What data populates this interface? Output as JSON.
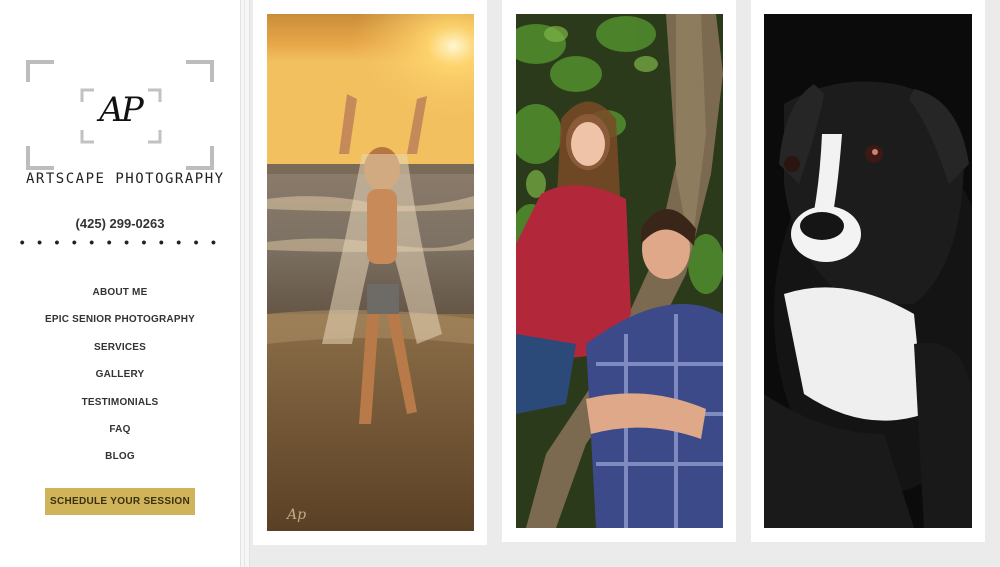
{
  "brand": {
    "monogram": "AP",
    "name": "ARTSCAPE PHOTOGRAPHY"
  },
  "contact": {
    "phone": "(425) 299-0263",
    "separator": "• • • • • • • • • • • •"
  },
  "nav": {
    "items": [
      {
        "label": "ABOUT ME"
      },
      {
        "label": "EPIC SENIOR PHOTOGRAPHY"
      },
      {
        "label": "SERVICES"
      },
      {
        "label": "GALLERY"
      },
      {
        "label": "TESTIMONIALS"
      },
      {
        "label": "FAQ"
      },
      {
        "label": "BLOG"
      }
    ]
  },
  "cta": {
    "label": "SCHEDULE YOUR SESSION"
  },
  "gallery": {
    "photos": [
      {
        "subject": "girl-on-beach-at-sunset"
      },
      {
        "subject": "senior-couple-by-tree"
      },
      {
        "subject": "black-and-white-dog-portrait"
      }
    ]
  },
  "colors": {
    "accent": "#cfb45a",
    "background": "#ebebeb"
  }
}
